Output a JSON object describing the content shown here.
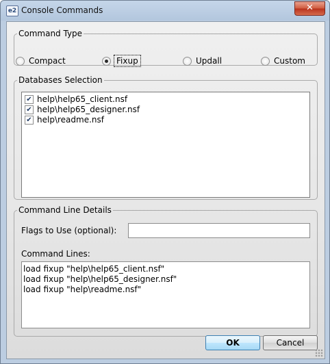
{
  "window": {
    "title": "Console Commands",
    "icon_text": "e2",
    "close_glyph": "✕"
  },
  "command_type": {
    "legend": "Command Type",
    "options": [
      {
        "label": "Compact",
        "checked": false
      },
      {
        "label": "Fixup",
        "checked": true
      },
      {
        "label": "Updall",
        "checked": false
      },
      {
        "label": "Custom",
        "checked": false
      }
    ]
  },
  "databases": {
    "legend": "Databases Selection",
    "items": [
      {
        "label": "help\\help65_client.nsf",
        "checked": true
      },
      {
        "label": "help\\help65_designer.nsf",
        "checked": true
      },
      {
        "label": "help\\readme.nsf",
        "checked": true
      }
    ],
    "check_glyph": "✔"
  },
  "details": {
    "legend": "Command Line Details",
    "flags_label": "Flags to Use (optional):",
    "flags_value": "",
    "command_lines_label": "Command Lines:",
    "command_lines": [
      "load fixup \"help\\help65_client.nsf\"",
      "load fixup \"help\\help65_designer.nsf\"",
      "load fixup \"help\\readme.nsf\""
    ]
  },
  "buttons": {
    "ok": "OK",
    "cancel": "Cancel"
  }
}
